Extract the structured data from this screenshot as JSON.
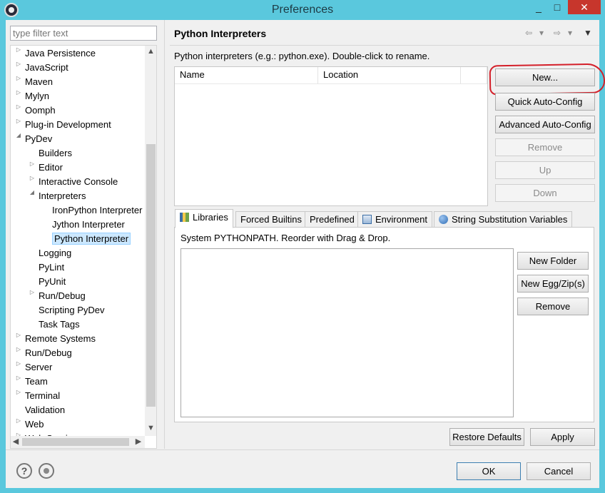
{
  "window": {
    "title": "Preferences",
    "minimize": "▭",
    "maximize": "□",
    "close": "✕"
  },
  "filter": {
    "placeholder": "type filter text"
  },
  "tree": {
    "items": [
      {
        "label": "Java Persistence",
        "arrow": "▷"
      },
      {
        "label": "JavaScript",
        "arrow": "▷"
      },
      {
        "label": "Maven",
        "arrow": "▷"
      },
      {
        "label": "Mylyn",
        "arrow": "▷"
      },
      {
        "label": "Oomph",
        "arrow": "▷"
      },
      {
        "label": "Plug-in Development",
        "arrow": "▷"
      },
      {
        "label": "PyDev",
        "arrow": "◢"
      },
      {
        "label": "Builders",
        "arrow": ""
      },
      {
        "label": "Editor",
        "arrow": "▷"
      },
      {
        "label": "Interactive Console",
        "arrow": "▷"
      },
      {
        "label": "Interpreters",
        "arrow": "◢"
      },
      {
        "label": "IronPython Interpreter",
        "arrow": ""
      },
      {
        "label": "Jython Interpreter",
        "arrow": ""
      },
      {
        "label": "Python Interpreter",
        "arrow": "",
        "selected": true
      },
      {
        "label": "Logging",
        "arrow": ""
      },
      {
        "label": "PyLint",
        "arrow": ""
      },
      {
        "label": "PyUnit",
        "arrow": ""
      },
      {
        "label": "Run/Debug",
        "arrow": "▷"
      },
      {
        "label": "Scripting PyDev",
        "arrow": ""
      },
      {
        "label": "Task Tags",
        "arrow": ""
      },
      {
        "label": "Remote Systems",
        "arrow": "▷"
      },
      {
        "label": "Run/Debug",
        "arrow": "▷"
      },
      {
        "label": "Server",
        "arrow": "▷"
      },
      {
        "label": "Team",
        "arrow": "▷"
      },
      {
        "label": "Terminal",
        "arrow": "▷"
      },
      {
        "label": "Validation",
        "arrow": ""
      },
      {
        "label": "Web",
        "arrow": "▷"
      },
      {
        "label": "Web Services",
        "arrow": "▷"
      }
    ],
    "scroll_up": "▲",
    "scroll_down": "▼",
    "scroll_left": "◀",
    "scroll_right": "▶"
  },
  "page": {
    "title": "Python Interpreters",
    "description": "Python interpreters (e.g.: python.exe).   Double-click to rename.",
    "nav": {
      "back": "⇦",
      "back_menu": "▾",
      "forward": "⇨",
      "forward_menu": "▾",
      "view_menu": "▼"
    }
  },
  "interpreters_table": {
    "columns": [
      "Name",
      "Location"
    ]
  },
  "side_buttons": {
    "new": "New...",
    "quick": "Quick Auto-Config",
    "advanced": "Advanced Auto-Config",
    "remove": "Remove",
    "up": "Up",
    "down": "Down"
  },
  "tabs": [
    "Libraries",
    "Forced Builtins",
    "Predefined",
    "Environment",
    "String Substitution Variables"
  ],
  "libraries": {
    "label": "System PYTHONPATH.   Reorder with Drag & Drop.",
    "new_folder": "New Folder",
    "new_egg": "New Egg/Zip(s)",
    "remove": "Remove"
  },
  "footer": {
    "restore_defaults": "Restore Defaults",
    "apply": "Apply",
    "ok": "OK",
    "cancel": "Cancel",
    "help": "?"
  },
  "colors": {
    "titlebar": "#5ac8dd",
    "close": "#c7362c",
    "selection": "#cce8ff",
    "annotation": "#d4202a"
  }
}
